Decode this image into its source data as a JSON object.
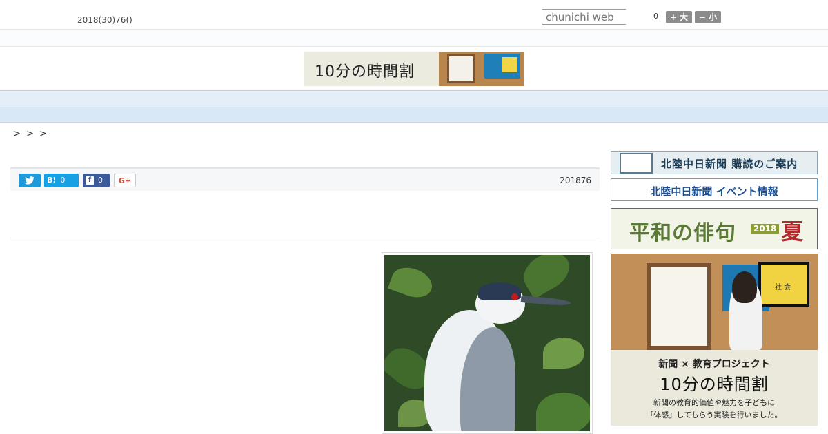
{
  "header": {
    "date": "2018(30)76()",
    "search_placeholder": "chunichi web",
    "font_count": "0",
    "font_larger": "+ 大",
    "font_smaller": "− 小"
  },
  "banner": {
    "text": "10分の時間割"
  },
  "nav": {
    "items": [
      "",
      "",
      "",
      "",
      "",
      "",
      "",
      "",
      ""
    ]
  },
  "breadcrumb": ">  >    >",
  "share": {
    "hatena_label": "B!",
    "hatena_count": "0",
    "facebook_count": "0",
    "gplus_label": "G+",
    "published": "201876"
  },
  "sidebar": {
    "subscribe_label": "北陸中日新聞 購読のご案内",
    "event_label": "北陸中日新聞 イベント情報",
    "haiku_label": "平和の俳句",
    "haiku_year": "2018",
    "haiku_season": "夏",
    "jikan_screen_label": "社 会",
    "jikan_line1": "新聞 × 教育プロジェクト",
    "jikan_line2": "10分の時間割",
    "jikan_line3": "新聞の教育的価値や魅力を子どもに",
    "jikan_line4": "「体感」してもらう実験を行いました。"
  },
  "colors": {
    "nav_bg": "#e3eef9",
    "twitter": "#1e9ad8",
    "hatena": "#17a1e4",
    "facebook": "#3d5a98",
    "event_border": "#5c9fd4"
  }
}
